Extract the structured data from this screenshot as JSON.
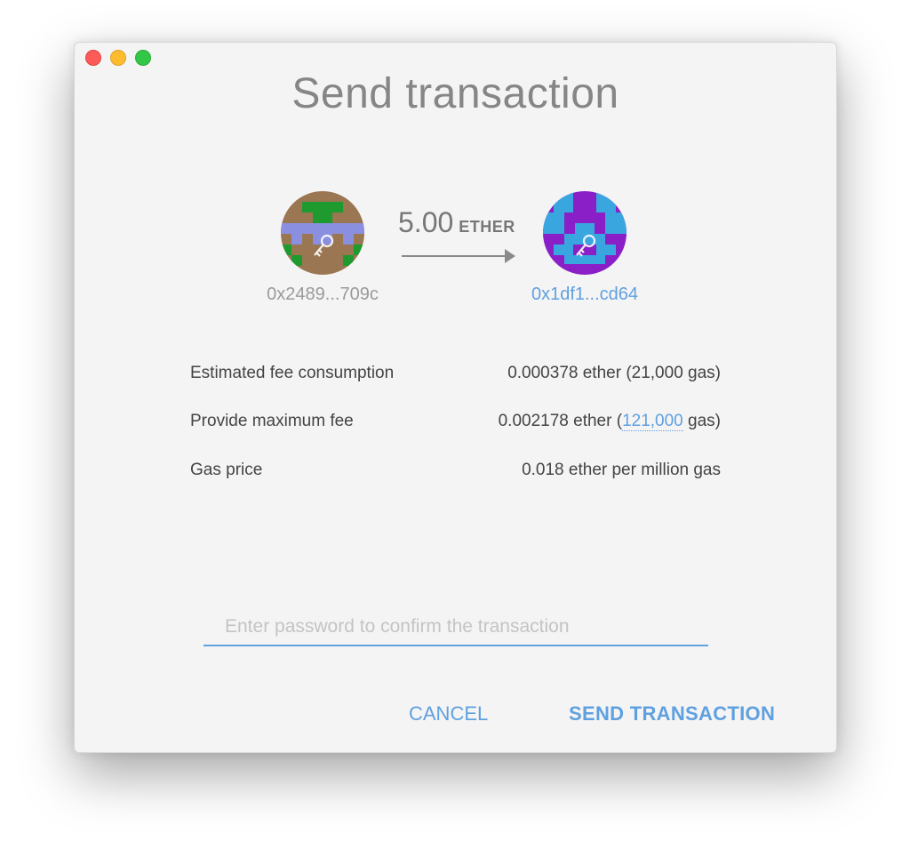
{
  "window": {
    "title": "Send transaction"
  },
  "transaction": {
    "amount": "5.00",
    "unit": "ETHER",
    "from_address": "0x2489...709c",
    "to_address": "0x1df1...cd64",
    "from_icon": "identicon-key-icon",
    "to_icon": "identicon-key-icon"
  },
  "fees": {
    "estimated_label": "Estimated fee consumption",
    "estimated_value": "0.000378 ether (21,000 gas)",
    "maximum_label": "Provide maximum fee",
    "maximum_prefix": "0.002178 ether (",
    "maximum_gas": "121,000",
    "maximum_suffix": " gas)",
    "gas_price_label": "Gas price",
    "gas_price_value": "0.018 ether per million gas"
  },
  "password": {
    "placeholder": "Enter password to confirm the transaction",
    "value": ""
  },
  "actions": {
    "cancel_label": "CANCEL",
    "send_label": "SEND TRANSACTION"
  },
  "colors": {
    "accent": "#5fa0e0",
    "window_bg": "#f5f4f4"
  }
}
